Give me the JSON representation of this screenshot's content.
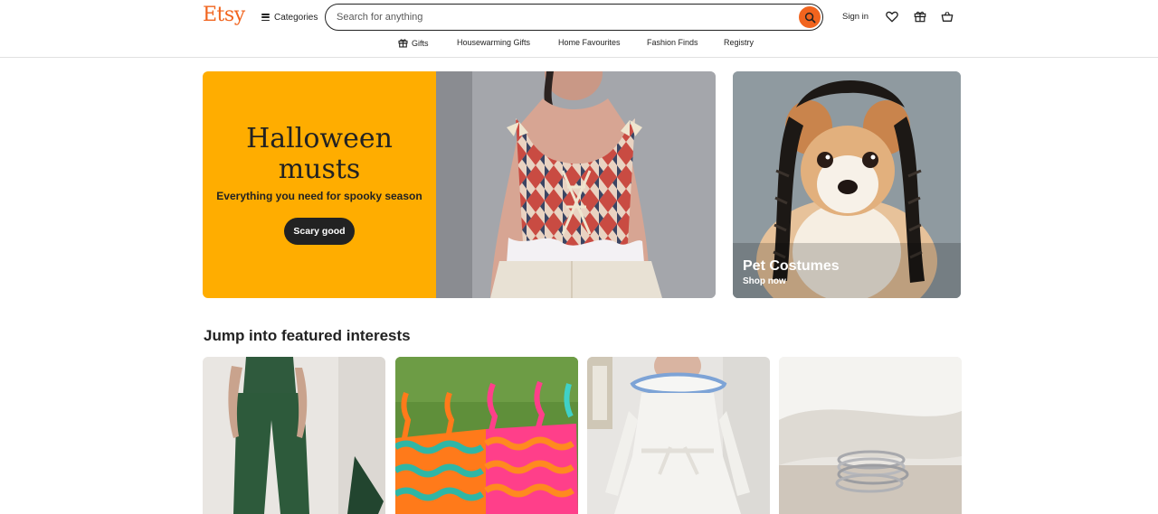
{
  "header": {
    "logo": "Etsy",
    "categories_label": "Categories",
    "search_placeholder": "Search for anything",
    "signin_label": "Sign in",
    "icons": [
      "search-icon",
      "heart-icon",
      "gift-icon",
      "basket-icon"
    ]
  },
  "subnav": {
    "items": [
      {
        "label": "Gifts",
        "icon": "gift-icon"
      },
      {
        "label": "Housewarming Gifts"
      },
      {
        "label": "Home Favourites"
      },
      {
        "label": "Fashion Finds"
      },
      {
        "label": "Registry"
      }
    ]
  },
  "hero": {
    "title_line1": "Halloween",
    "title_line2": "musts",
    "subtitle": "Everything you need for spooky season",
    "button_label": "Scary good"
  },
  "pet": {
    "title": "Pet Costumes",
    "cta": "Shop now"
  },
  "featured": {
    "title": "Jump into featured interests",
    "tiles": [
      "green-suit-photo",
      "knit-tops-photo",
      "white-costume-photo",
      "silver-rings-photo"
    ]
  },
  "colors": {
    "brand": "#f1641e",
    "hero_bg": "#ffad00",
    "dark": "#222222"
  }
}
